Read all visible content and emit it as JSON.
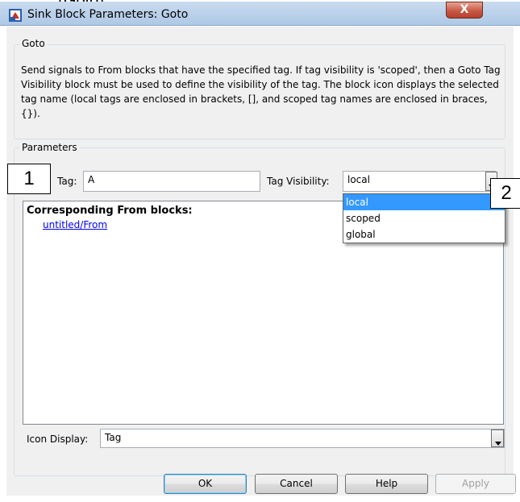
{
  "caption_top": "... (Goto)",
  "window": {
    "title": "Sink Block Parameters: Goto",
    "close_glyph": "X"
  },
  "goto_group": {
    "label": "Goto",
    "description": "Send signals to From blocks that have the specified tag.  If tag visibility is 'scoped', then a Goto Tag Visibility block must be used to define the visibility of the tag.  The block icon displays the selected tag name (local tags are enclosed in brackets, [], and scoped tag names are enclosed in braces, {})."
  },
  "parameters_group": {
    "label": "Parameters",
    "tag_label": "Tag:",
    "tag_value": "A",
    "visibility_label": "Tag Visibility:",
    "visibility_value": "local",
    "visibility_options": [
      "local",
      "scoped",
      "global"
    ],
    "corresponding_heading": "Corresponding From blocks:",
    "corresponding_link": "untitled/From",
    "icon_display_label": "Icon Display:",
    "icon_display_value": "Tag"
  },
  "buttons": {
    "ok": "OK",
    "cancel": "Cancel",
    "help": "Help",
    "apply": "Apply"
  },
  "callouts": {
    "one": "1",
    "two": "2"
  },
  "colors": {
    "selection": "#3399ff",
    "link": "#0000ee",
    "close_button": "#c75a45"
  }
}
